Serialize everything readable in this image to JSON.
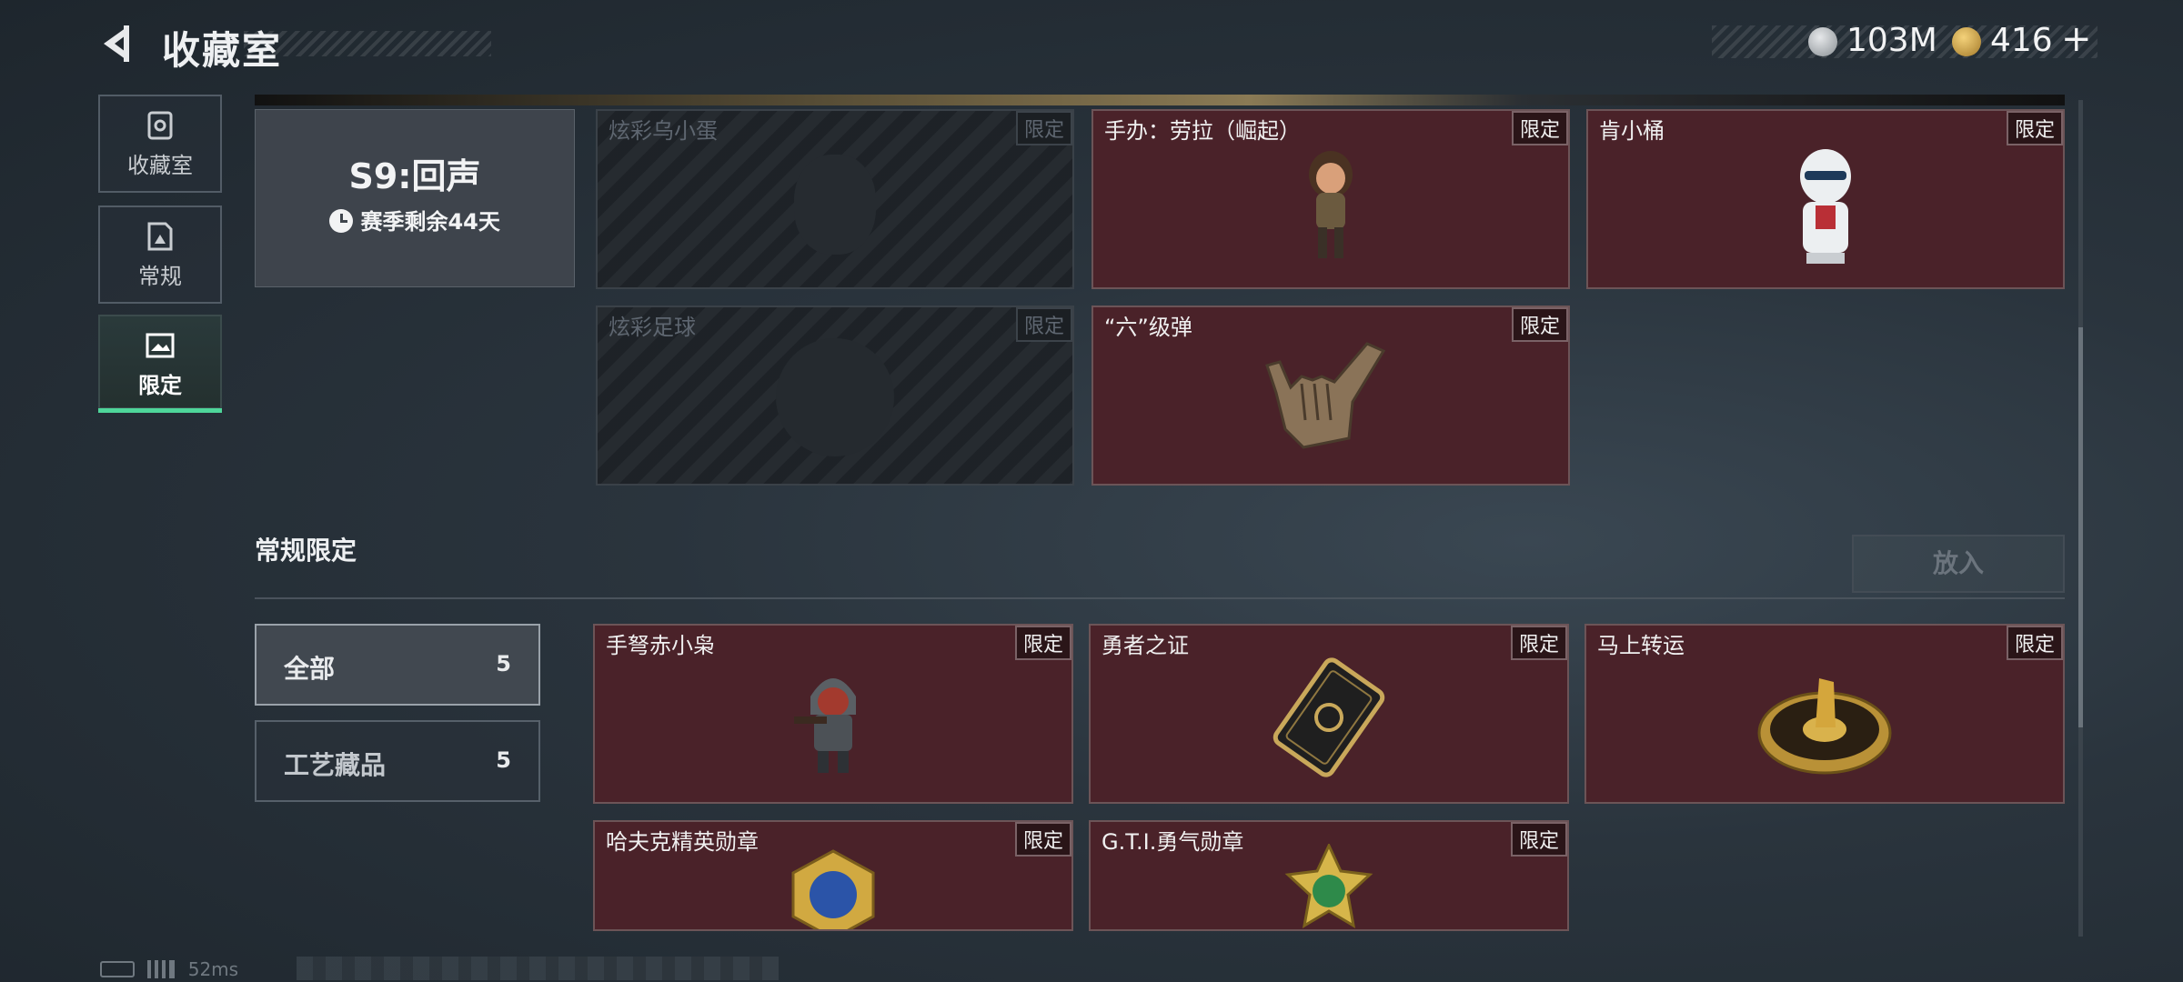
{
  "header": {
    "title": "收藏室"
  },
  "currency": [
    {
      "icon": "silver-coin-icon",
      "value": "103M"
    },
    {
      "icon": "gold-coin-icon",
      "value": "416"
    }
  ],
  "add_symbol": "+",
  "nav": [
    {
      "label": "收藏室",
      "icon": "trophy-icon"
    },
    {
      "label": "常规",
      "icon": "card-icon"
    },
    {
      "label": "限定",
      "icon": "image-icon",
      "active": true
    }
  ],
  "season": {
    "title": "S9:回声",
    "remaining": "赛季剩余44天"
  },
  "limited_items": [
    {
      "name": "炫彩乌小蛋",
      "tag": "限定",
      "locked": true
    },
    {
      "name": "手办：劳拉（崛起）",
      "tag": "限定",
      "locked": false
    },
    {
      "name": "肯小桶",
      "tag": "限定",
      "locked": false
    },
    {
      "name": "炫彩足球",
      "tag": "限定",
      "locked": true
    },
    {
      "name": "“六”级弹",
      "tag": "限定",
      "locked": false
    }
  ],
  "section": {
    "title": "常规限定",
    "put_button": "放入"
  },
  "filters": [
    {
      "label": "全部",
      "count": "5",
      "selected": true
    },
    {
      "label": "工艺藏品",
      "count": "5",
      "selected": false
    }
  ],
  "regular_items": [
    {
      "name": "手弩赤小枭",
      "tag": "限定"
    },
    {
      "name": "勇者之证",
      "tag": "限定"
    },
    {
      "name": "马上转运",
      "tag": "限定"
    },
    {
      "name": "哈夫克精英勋章",
      "tag": "限定"
    },
    {
      "name": "G.T.I.勇气勋章",
      "tag": "限定"
    }
  ],
  "status": {
    "ping": "52ms"
  },
  "colors": {
    "accent": "#4ed69a",
    "tile_bg": "#4a2229",
    "locked_bg": "#1f2429"
  }
}
